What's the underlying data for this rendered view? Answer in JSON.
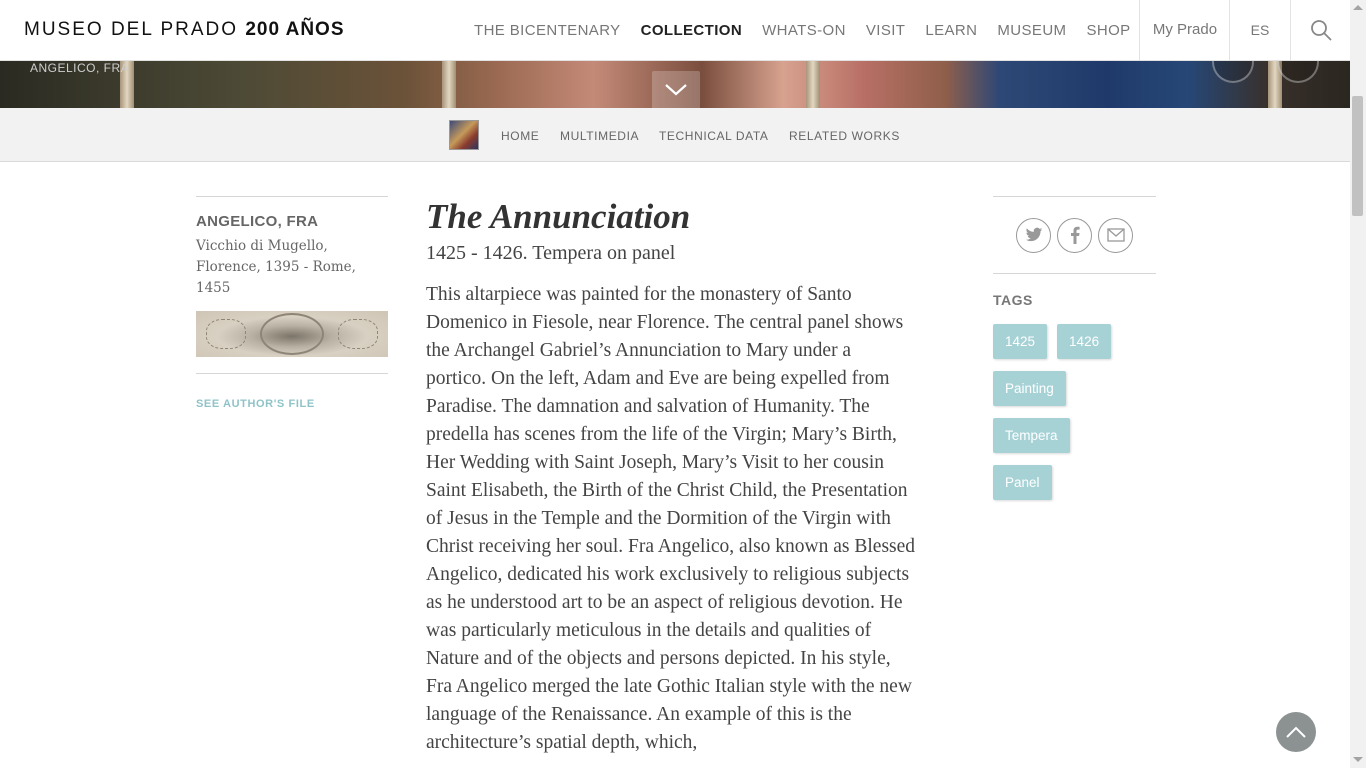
{
  "header": {
    "logo_text": "MUSEO DEL PRADO",
    "logo_bold": "200 AÑOS",
    "nav": [
      {
        "label": "THE BICENTENARY"
      },
      {
        "label": "COLLECTION"
      },
      {
        "label": "WHATS-ON"
      },
      {
        "label": "VISIT"
      },
      {
        "label": "LEARN"
      },
      {
        "label": "MUSEUM"
      },
      {
        "label": "SHOP"
      }
    ],
    "active_nav": "COLLECTION",
    "my_prado": "My Prado",
    "language": "ES",
    "search_icon": "search-icon"
  },
  "hero": {
    "label": "ANGELICO, FRA",
    "toggle_icon": "chevron-down-icon"
  },
  "subnav": {
    "items": [
      {
        "label": "HOME"
      },
      {
        "label": "MULTIMEDIA"
      },
      {
        "label": "TECHNICAL DATA"
      },
      {
        "label": "RELATED WORKS"
      }
    ]
  },
  "author": {
    "name": "ANGELICO, FRA",
    "info": "Vicchio di Mugello, Florence, 1395 - Rome, 1455",
    "see_file": "SEE AUTHOR'S FILE"
  },
  "artwork": {
    "title": "The Annunciation",
    "subtitle": "1425 - 1426. Tempera on panel",
    "description": "This altarpiece was painted for the monastery of Santo Domenico in Fiesole, near Florence. The central panel shows the Archangel Gabriel’s Annunciation to Mary under a portico. On the left, Adam and Eve are being expelled from Paradise. The damnation and salvation of Humanity. The predella has scenes from the life of the Virgin; Mary’s Birth, Her Wedding with Saint Joseph, Mary’s Visit to her cousin Saint Elisabeth, the Birth of the Christ Child, the Presentation of Jesus in the Temple and the Dormition of the Virgin with Christ receiving her soul. Fra Angelico, also known as Blessed Angelico, dedicated his work exclusively to religious subjects as he understood art to be an aspect of religious devotion. He was particularly meticulous in the details and qualities of Nature and of the objects and persons depicted. In his style, Fra Angelico merged the late Gothic Italian style with the new language of the Renaissance. An example of this is the architecture’s spatial depth, which,"
  },
  "share": {
    "icons": [
      "twitter-icon",
      "facebook-icon",
      "email-icon"
    ]
  },
  "tags": {
    "label": "TAGS",
    "items": [
      {
        "label": "1425"
      },
      {
        "label": "1426"
      },
      {
        "label": "Painting"
      },
      {
        "label": "Tempera"
      },
      {
        "label": "Panel"
      }
    ]
  },
  "colors": {
    "tag_bg": "#a6d2d6",
    "link": "#8fc3c8"
  },
  "back_to_top_icon": "chevron-up-icon"
}
